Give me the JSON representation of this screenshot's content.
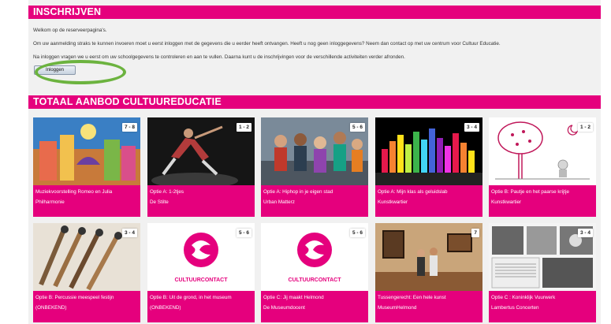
{
  "inschrijven": {
    "title": "INSCHRIJVEN",
    "welcome": "Welkom op de reserveerpagina's.",
    "line2": "Om uw aanmelding straks te kunnen invoeren moet u eerst inloggen met de gegevens die u eerder heeft ontvangen. Heeft u nog geen inloggegevens? Neem dan contact op met uw centrum voor Cultuur Educatie.",
    "line3": "Na inloggen vragen we u eerst om uw schoolgegevens te controleren en aan te vullen. Daarna kunt u de inschrijvingen voor de verschillende activiteiten verder afronden.",
    "login_button": "Inloggen"
  },
  "aanbod": {
    "title": "TOTAAL AANBOD CULTUUREDUCATIE",
    "cards": [
      {
        "badge": "7 - 8",
        "line1": "Muziekvoorstelling Romeo en Julia",
        "line2": "Philharmonie",
        "thumb_icon": "cartoon-city-icon"
      },
      {
        "badge": "1 - 2",
        "line1": "Optie A: 1-2tjes",
        "line2": "De Stilte",
        "thumb_icon": "dancers-icon"
      },
      {
        "badge": "5 - 6",
        "line1": "Optie A: Hiphop in je eigen stad",
        "line2": "Urban Matterz",
        "thumb_icon": "hiphop-group-icon"
      },
      {
        "badge": "3 - 4",
        "line1": "Optie A: Mijn klas als geluidslab",
        "line2": "Kunstkwartier",
        "thumb_icon": "equalizer-icon"
      },
      {
        "badge": "1 - 2",
        "line1": "Optie B: Pautje en het paarse krijtje",
        "line2": "Kunstkwartier",
        "thumb_icon": "tree-drawing-icon"
      },
      {
        "badge": "3 - 4",
        "line1": "Optie B: Percussie meespeel festijn",
        "line2": "(ONBEKEND)",
        "thumb_icon": "percussion-sticks-icon"
      },
      {
        "badge": "5 - 6",
        "line1": "Optie B: Uit de grond, in het museum",
        "line2": "(ONBEKEND)",
        "thumb_icon": "cultuurcontact-logo-icon",
        "logo_text": "CULTUURCONTACT"
      },
      {
        "badge": "5 - 6",
        "line1": "Optie C: Jij maakt Helmond",
        "line2": "De Museumdocent",
        "thumb_icon": "cultuurcontact-logo-icon",
        "logo_text": "CULTUURCONTACT"
      },
      {
        "badge": "7",
        "line1": "Tussengerecht: Een hele kunst",
        "line2": "MuseumHelmond",
        "thumb_icon": "museum-visit-icon"
      },
      {
        "badge": "3 - 4",
        "line1": "Optie C : Koninklijk Vuurwerk",
        "line2": "Lambertus Concerten",
        "thumb_icon": "sheet-music-icon"
      }
    ]
  },
  "colors": {
    "brand": "#e5007d",
    "highlight": "#6cb33f",
    "page_bg": "#f1f1f1"
  }
}
